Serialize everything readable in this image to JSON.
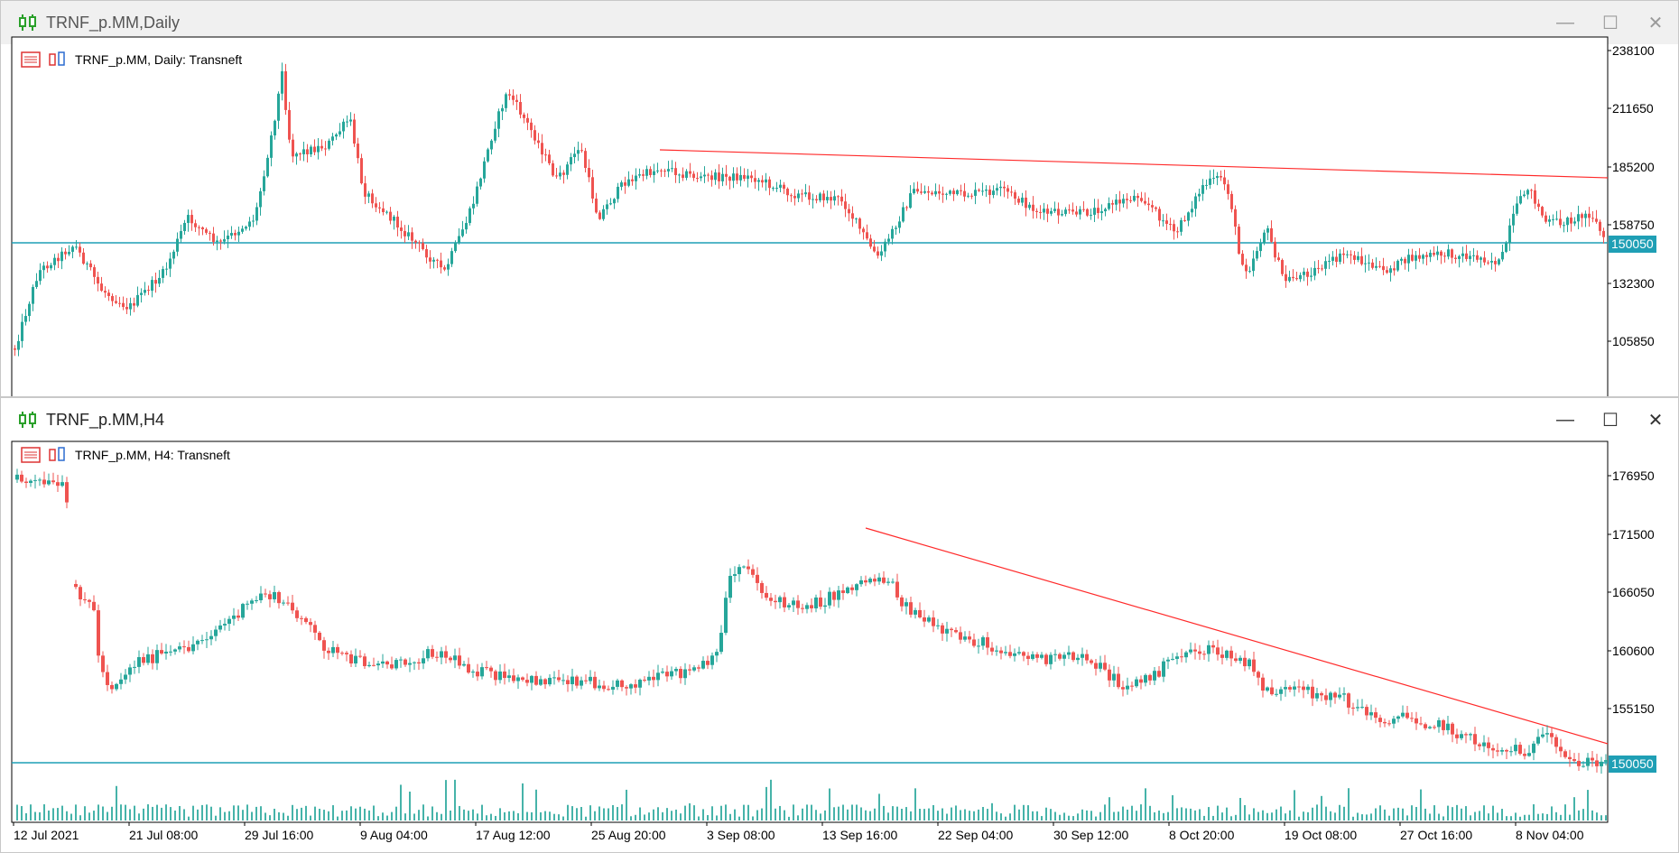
{
  "windows": [
    {
      "title": "TRNF_p.MM,Daily",
      "legend": "TRNF_p.MM, Daily:  Transneft",
      "price_labels": [
        "238100",
        "211650",
        "185200",
        "158750",
        "132300",
        "105850"
      ],
      "current_price": "150050"
    },
    {
      "title": "TRNF_p.MM,H4",
      "legend": "TRNF_p.MM, H4:  Transneft",
      "price_labels": [
        "176950",
        "171500",
        "166050",
        "160600",
        "155150"
      ],
      "current_price": "150050",
      "time_labels": [
        "12 Jul 2021",
        "21 Jul 08:00",
        "29 Jul 16:00",
        "9 Aug 04:00",
        "17 Aug 12:00",
        "25 Aug 20:00",
        "3 Sep 08:00",
        "13 Sep 16:00",
        "22 Sep 04:00",
        "30 Sep 12:00",
        "8 Oct 20:00",
        "19 Oct 08:00",
        "27 Oct 16:00",
        "8 Nov 04:00"
      ]
    }
  ],
  "controls": {
    "minimize": "—",
    "maximize": "☐",
    "close": "✕"
  },
  "colors": {
    "bull": "#26a69a",
    "bear": "#ef5350",
    "trendline": "#ff2a2a",
    "hline": "#1f9fb5"
  }
}
